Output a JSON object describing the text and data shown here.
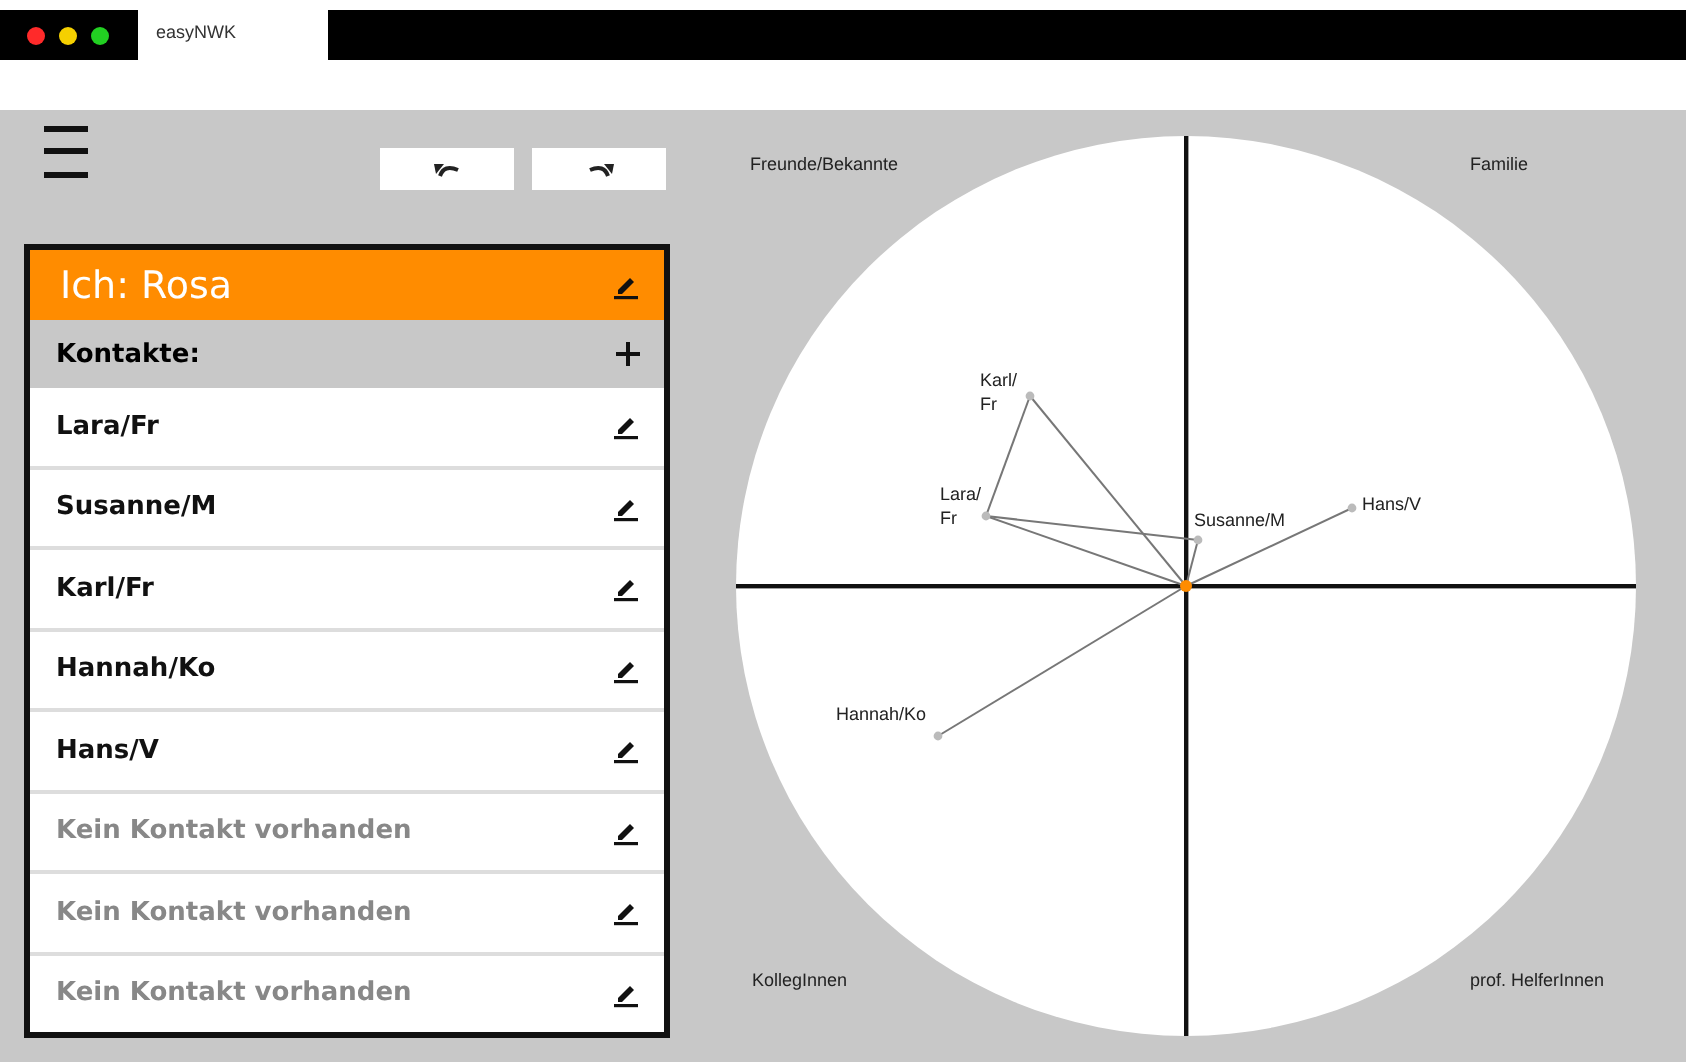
{
  "window": {
    "tabs": [
      {
        "label": "easyNWK",
        "selected": true
      }
    ]
  },
  "toolbar": {
    "buttons": [
      {
        "kind": "undo"
      },
      {
        "kind": "redo"
      }
    ]
  },
  "ego": {
    "label": "Ich: Rosa"
  },
  "contacts_header": {
    "label": "Kontakte:"
  },
  "contacts": [
    {
      "name": "Lara/Fr",
      "empty": false
    },
    {
      "name": "Susanne/M",
      "empty": false
    },
    {
      "name": "Karl/Fr",
      "empty": false
    },
    {
      "name": "Hannah/Ko",
      "empty": false
    },
    {
      "name": "Hans/V",
      "empty": false
    },
    {
      "name": "Kein Kontakt vorhanden",
      "empty": true
    },
    {
      "name": "Kein Kontakt vorhanden",
      "empty": true
    },
    {
      "name": "Kein Kontakt vorhanden",
      "empty": true
    }
  ],
  "network": {
    "quadrants": [
      "Freunde/Bekannte",
      "Familie",
      "KollegInnen",
      "prof. HelferInnen"
    ],
    "nodes": [
      {
        "label": "Karl/Fr"
      },
      {
        "label": "Lara/Fr"
      },
      {
        "label": "Susanne/M"
      },
      {
        "label": "Hans/V"
      },
      {
        "label": "Hannah/Ko"
      }
    ]
  }
}
